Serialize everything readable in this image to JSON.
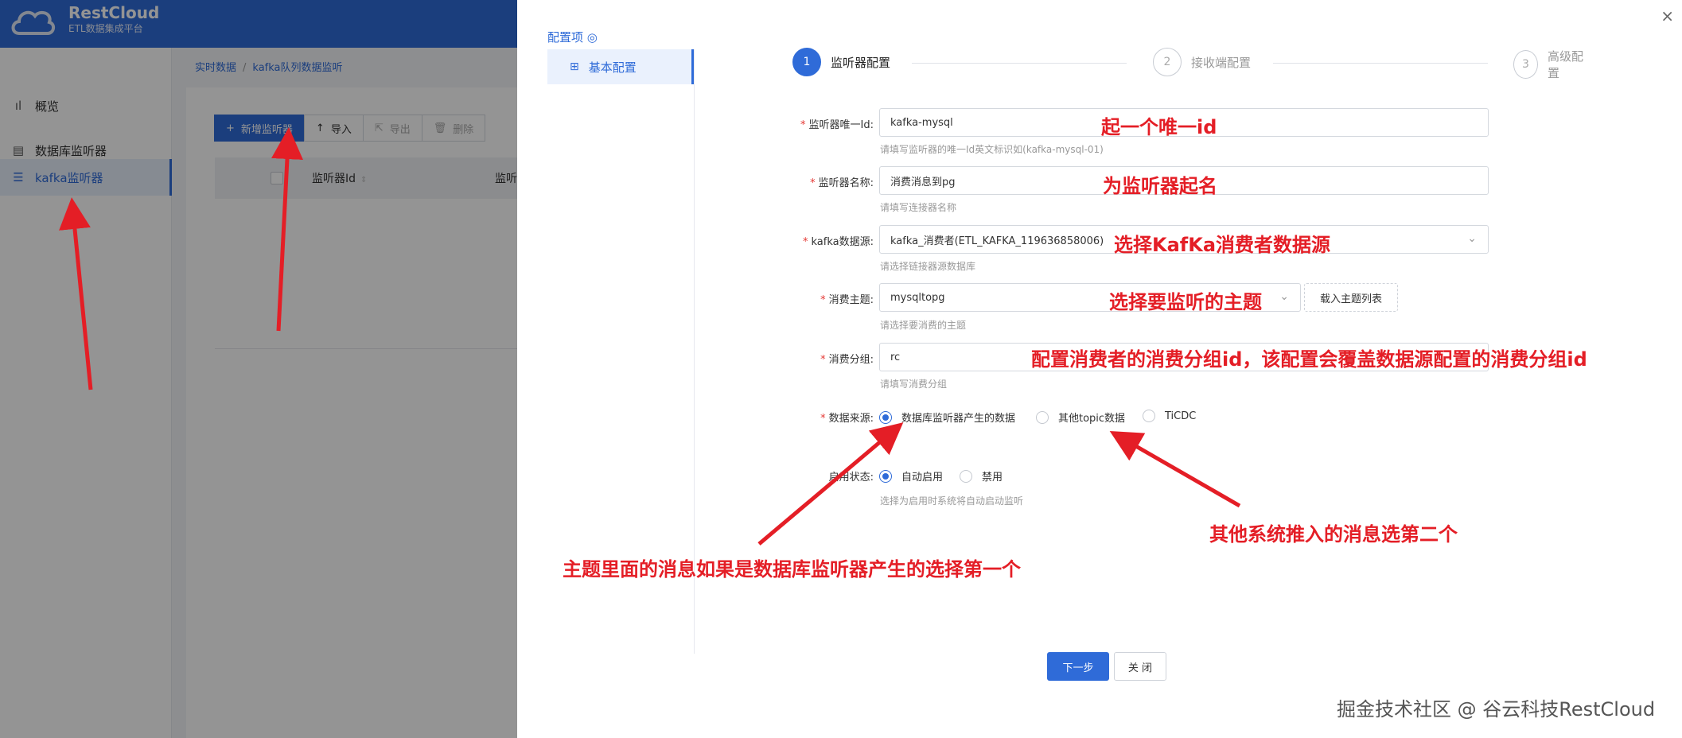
{
  "app": {
    "brand_name": "RestCloud",
    "brand_sub": "ETL数据集成平台"
  },
  "sidebar": {
    "items": [
      {
        "label": "概览",
        "icon": "bar-chart-icon"
      },
      {
        "label": "数据库监听器",
        "icon": "database-icon"
      },
      {
        "label": "kafka监听器",
        "icon": "kafka-icon",
        "active": true
      }
    ]
  },
  "breadcrumb": {
    "root": "实时数据",
    "separator": "/",
    "current": "kafka队列数据监听"
  },
  "toolbar": {
    "add_label": "新增监听器",
    "import_label": "导入",
    "export_label": "导出",
    "delete_label": "删除"
  },
  "table": {
    "columns": [
      "监听器Id",
      "监听"
    ]
  },
  "drawer": {
    "close_glyph": "×",
    "config_title": "配置项",
    "config_title_icon": "◎",
    "menu_item": "基本配置",
    "steps": [
      {
        "num": "1",
        "label": "监听器配置",
        "active": true
      },
      {
        "num": "2",
        "label": "接收端配置"
      },
      {
        "num": "3",
        "label": "高级配置"
      }
    ],
    "form": {
      "listener_id": {
        "label": "监听器唯一Id:",
        "value": "kafka-mysql",
        "hint": "请填写监听器的唯一Id英文标识如(kafka-mysql-01)"
      },
      "listener_name": {
        "label": "监听器名称:",
        "value": "消费消息到pg",
        "hint": "请填写连接器名称"
      },
      "kafka_source": {
        "label": "kafka数据源:",
        "value": "kafka_消费者(ETL_KAFKA_119636858006)",
        "hint": "请选择链接器源数据库"
      },
      "topic": {
        "label": "消费主题:",
        "value": "mysqltopg",
        "hint": "请选择要消费的主题",
        "load_button": "载入主题列表"
      },
      "group": {
        "label": "消费分组:",
        "value": "rc",
        "hint": "请填写消费分组"
      },
      "data_source": {
        "label": "数据来源:",
        "options": [
          "数据库监听器产生的数据",
          "其他topic数据",
          "TiCDC"
        ],
        "selected": 0
      },
      "status": {
        "label": "启用状态:",
        "options": [
          "自动启用",
          "禁用"
        ],
        "selected": 0,
        "hint": "选择为启用时系统将自动启动监听"
      }
    },
    "next_button": "下一步",
    "close_button": "关 闭"
  },
  "annotations": {
    "a1": "起一个唯一id",
    "a2": "为监听器起名",
    "a3": "选择KafKa消费者数据源",
    "a4": "选择要监听的主题",
    "a5": "配置消费者的消费分组id，该配置会覆盖数据源配置的消费分组id",
    "a6": "主题里面的消息如果是数据库监听器产生的选择第一个",
    "a7": "其他系统推入的消息选第二个"
  },
  "watermark": "掘金技术社区 @ 谷云科技RestCloud",
  "colors": {
    "primary": "#2f6bd8",
    "annotation_red": "#e41e26",
    "required_star": "#e53935"
  }
}
